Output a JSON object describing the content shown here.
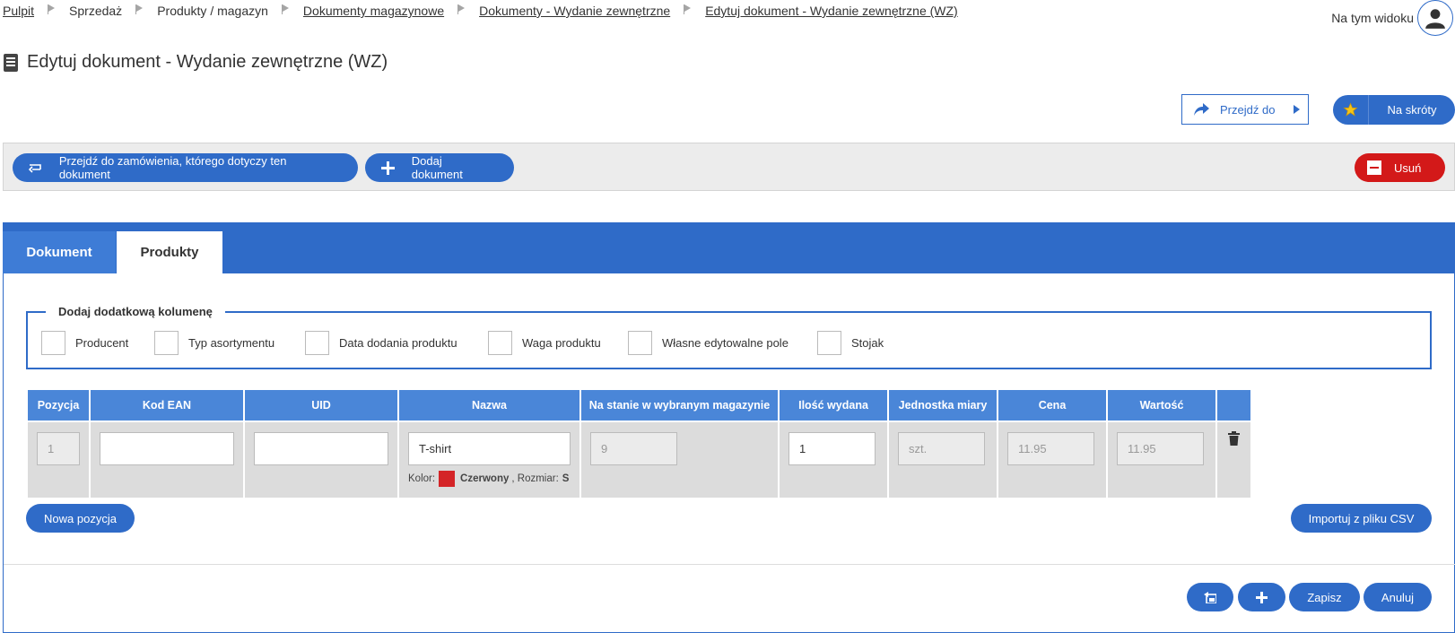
{
  "breadcrumb": [
    {
      "label": "Pulpit",
      "link": true
    },
    {
      "label": "Sprzedaż",
      "link": false
    },
    {
      "label": "Produkty / magazyn",
      "link": false
    },
    {
      "label": "Dokumenty magazynowe",
      "link": true
    },
    {
      "label": "Dokumenty - Wydanie zewnętrzne",
      "link": true
    },
    {
      "label": "Edytuj dokument - Wydanie zewnętrzne (WZ)",
      "link": true
    }
  ],
  "view": {
    "label": "Na tym widoku"
  },
  "page": {
    "title": "Edytuj dokument - Wydanie zewnętrzne (WZ)"
  },
  "top_buttons": {
    "goto": "Przejdź do",
    "shortcuts": "Na skróty"
  },
  "actions": {
    "goto_order": "Przejdź do zamówienia, którego dotyczy ten dokument",
    "add_document": "Dodaj dokument",
    "delete": "Usuń"
  },
  "tabs": [
    {
      "label": "Dokument",
      "active": false
    },
    {
      "label": "Produkty",
      "active": true
    }
  ],
  "columns_box": {
    "legend": "Dodaj dodatkową kolumenę",
    "options": [
      "Producent",
      "Typ asortymentu",
      "Data dodania produktu",
      "Waga produktu",
      "Własne edytowalne pole",
      "Stojak"
    ]
  },
  "table": {
    "headers": [
      "Pozycja",
      "Kod EAN",
      "UID",
      "Nazwa",
      "Na stanie w wybranym magazynie",
      "Ilość wydana",
      "Jednostka miary",
      "Cena",
      "Wartość"
    ],
    "row": {
      "position": "1",
      "ean": "",
      "uid": "",
      "name": "T-shirt",
      "color_label": "Kolor:",
      "color_value": "Czerwony",
      "size_label": ", Rozmiar:",
      "size_value": "S",
      "color_hex": "#d42427",
      "stock": "9",
      "qty": "1",
      "unit": "szt.",
      "price": "11.95",
      "value": "11.95"
    }
  },
  "bottom": {
    "new_position": "Nowa pozycja",
    "import_csv": "Importuj z pliku CSV",
    "save": "Zapisz",
    "cancel": "Anuluj"
  },
  "colors": {
    "primary": "#2f6bc8",
    "danger": "#d31919",
    "header": "#4a86d8"
  },
  "icons": [
    "avatar-icon",
    "document-icon",
    "share-arrow-icon",
    "caret-right-icon",
    "star-icon",
    "swap-arrow-icon",
    "plus-icon",
    "minus-box-icon",
    "trash-icon",
    "back-to-list-icon"
  ]
}
